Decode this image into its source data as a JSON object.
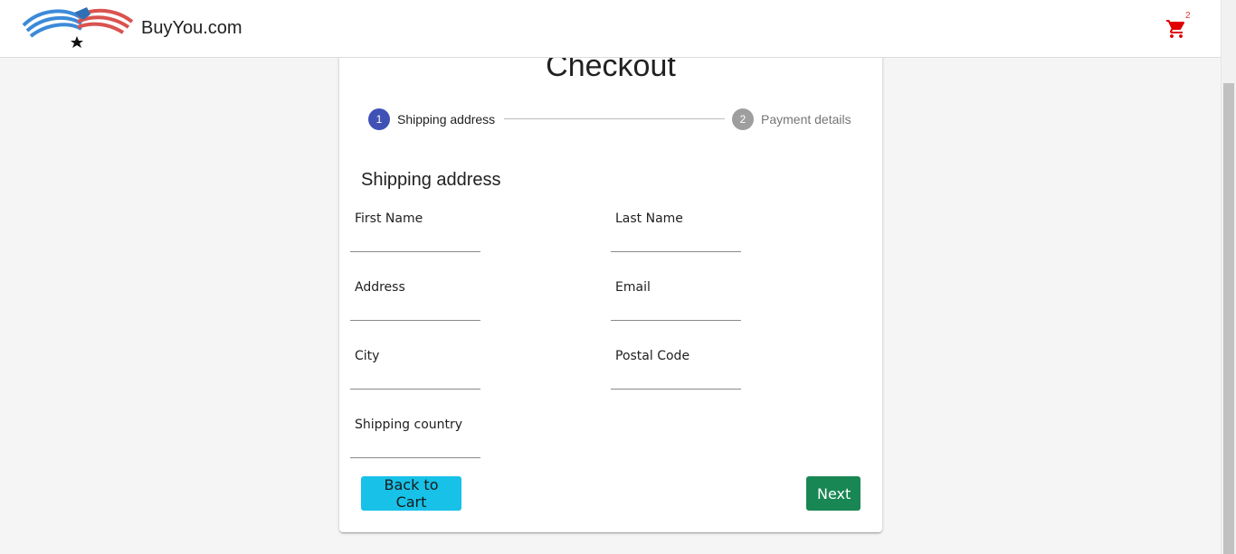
{
  "header": {
    "brand": "BuyYou.com",
    "cart_count": "2",
    "cart_color": "#e00000"
  },
  "checkout": {
    "title": "Checkout",
    "steps": [
      {
        "number": "1",
        "label": "Shipping address",
        "active": true
      },
      {
        "number": "2",
        "label": "Payment details",
        "active": false
      }
    ],
    "section_title": "Shipping address",
    "fields": {
      "first_name": {
        "label": "First Name",
        "value": ""
      },
      "last_name": {
        "label": "Last Name",
        "value": ""
      },
      "address": {
        "label": "Address",
        "value": ""
      },
      "email": {
        "label": "Email",
        "value": ""
      },
      "city": {
        "label": "City",
        "value": ""
      },
      "postal_code": {
        "label": "Postal Code",
        "value": ""
      },
      "shipping_country": {
        "label": "Shipping country",
        "value": ""
      }
    },
    "buttons": {
      "back": "Back to Cart",
      "next": "Next"
    }
  },
  "colors": {
    "step_active": "#3f51b5",
    "step_inactive": "#9e9e9e",
    "back_button": "#17c1e8",
    "next_button": "#198754"
  }
}
